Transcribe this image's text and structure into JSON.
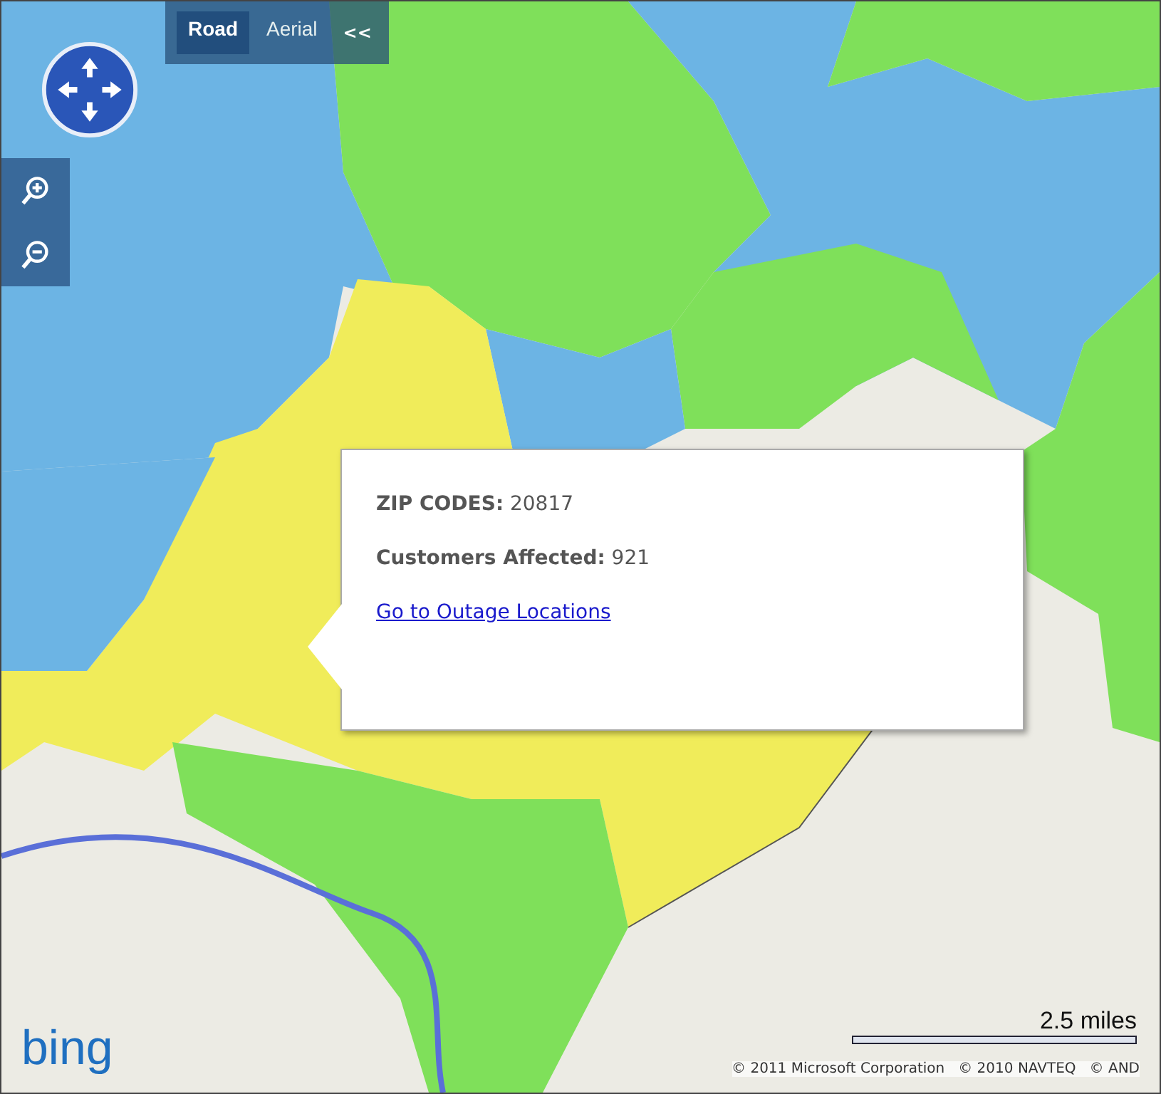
{
  "map_type_tabs": [
    {
      "label": "Road",
      "selected": true
    },
    {
      "label": "Aerial",
      "selected": false
    }
  ],
  "collapse_toggle": "<<",
  "popup": {
    "lines": [
      {
        "kind": "field",
        "label": "ZIP CODES:",
        "value": "20817"
      },
      {
        "kind": "field",
        "label": "Customers Affected:",
        "value": "921"
      },
      {
        "kind": "link",
        "label": "Go to Outage Locations"
      }
    ]
  },
  "scale": {
    "label": "2.5 miles"
  },
  "logo": "bing",
  "copyright": "© 2011 Microsoft Corporation   © 2010 NAVTEQ   © AND"
}
